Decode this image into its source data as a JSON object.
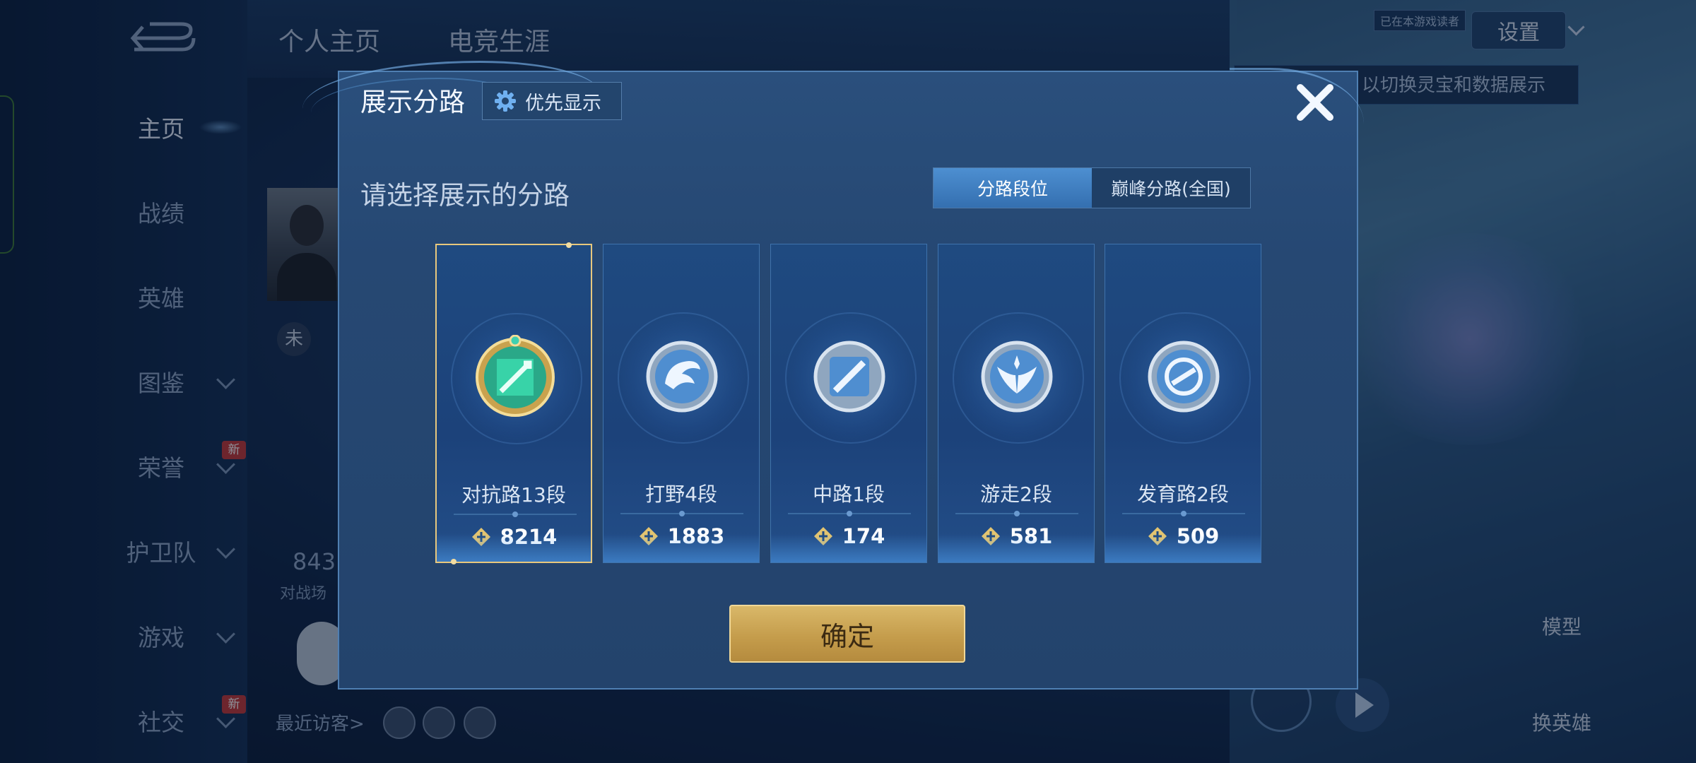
{
  "background": {
    "back_icon": "back-arrow-icon",
    "top_tabs": [
      "个人主页",
      "电竞生涯"
    ],
    "sidebar": [
      {
        "label": "主页",
        "active": true,
        "chevron": false,
        "badge": ""
      },
      {
        "label": "战绩",
        "active": false,
        "chevron": false,
        "badge": ""
      },
      {
        "label": "英雄",
        "active": false,
        "chevron": false,
        "badge": ""
      },
      {
        "label": "图鉴",
        "active": false,
        "chevron": true,
        "badge": ""
      },
      {
        "label": "荣誉",
        "active": false,
        "chevron": true,
        "badge": "新"
      },
      {
        "label": "护卫队",
        "active": false,
        "chevron": true,
        "badge": ""
      },
      {
        "label": "游戏",
        "active": false,
        "chevron": true,
        "badge": ""
      },
      {
        "label": "社交",
        "active": false,
        "chevron": true,
        "badge": "新"
      }
    ],
    "settings_label": "设置",
    "game_tag": "已在本游戏读者",
    "hint_text": "以切换灵宝和数据展示",
    "rank_text": "未",
    "count_value": "843",
    "count_label": "对战场",
    "recent_visitors": "最近访客>",
    "right_labels": [
      "模型",
      "换英雄"
    ]
  },
  "dialog": {
    "title": "展示分路",
    "priority_button": "优先显示",
    "subtitle": "请选择展示的分路",
    "tabs": [
      {
        "label": "分路段位",
        "active": true
      },
      {
        "label": "巅峰分路(全国)",
        "active": false
      }
    ],
    "roles": [
      {
        "name": "对抗路13段",
        "score": "8214",
        "selected": true,
        "emblem": "sword-emblem-icon"
      },
      {
        "name": "打野4段",
        "score": "1883",
        "selected": false,
        "emblem": "dragon-emblem-icon"
      },
      {
        "name": "中路1段",
        "score": "174",
        "selected": false,
        "emblem": "mid-lane-emblem-icon"
      },
      {
        "name": "游走2段",
        "score": "581",
        "selected": false,
        "emblem": "wings-emblem-icon"
      },
      {
        "name": "发育路2段",
        "score": "509",
        "selected": false,
        "emblem": "target-emblem-icon"
      }
    ],
    "confirm_label": "确定",
    "colors": {
      "accent_gold": "#e8c87d",
      "tab_active": "#3f82c4",
      "panel": "#264873"
    }
  }
}
